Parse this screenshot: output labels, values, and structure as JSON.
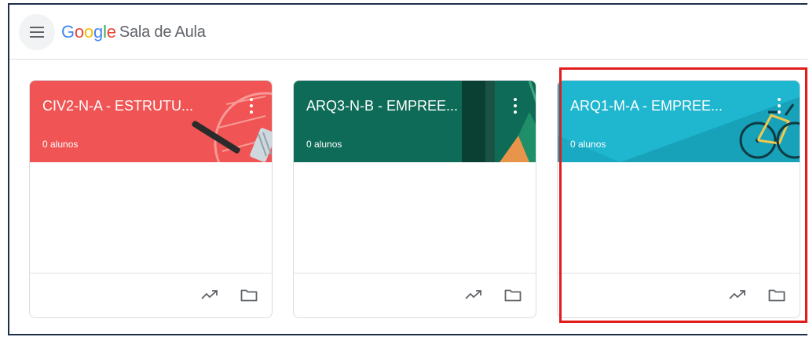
{
  "app": {
    "brand": [
      "G",
      "o",
      "o",
      "g",
      "l",
      "e"
    ],
    "product": "Sala de Aula"
  },
  "icons": {
    "menu": "hamburger-menu-icon",
    "more": "more-vert-icon",
    "trend": "trending-up-icon",
    "folder": "folder-icon"
  },
  "classes": [
    {
      "title": "CIV2-N-A - ESTRUTU...",
      "students": "0 alunos",
      "color": "#f05454"
    },
    {
      "title": "ARQ3-N-B - EMPREE...",
      "students": "0 alunos",
      "color": "#0d6b57"
    },
    {
      "title": "ARQ1-M-A - EMPREE...",
      "students": "0 alunos",
      "color": "#1fb6cf"
    }
  ],
  "highlight_color": "#e21b1b"
}
